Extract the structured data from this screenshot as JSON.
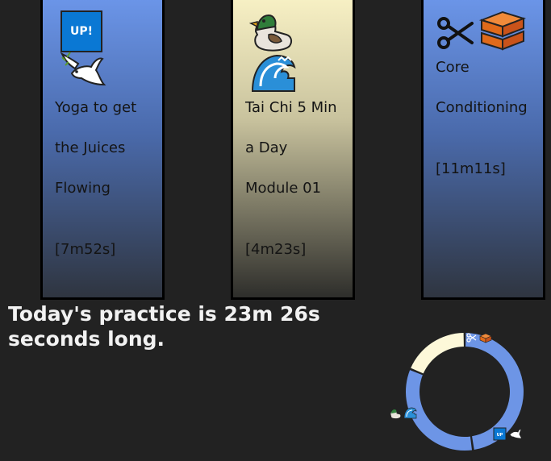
{
  "cards": [
    {
      "icons": [
        "up-badge-icon",
        "dove-icon"
      ],
      "badge_text": "UP!",
      "title_lines": [
        "Yoga to get",
        "the Juices",
        "Flowing"
      ],
      "duration": "[7m52s]",
      "color": "#6b95e8"
    },
    {
      "icons": [
        "duck-icon",
        "wave-icon"
      ],
      "title_lines": [
        "Tai Chi 5 Min",
        "a Day",
        "Module 01"
      ],
      "duration": "[4m23s]",
      "color": "#f7f0c4"
    },
    {
      "icons": [
        "scissors-icon",
        "brick-icon"
      ],
      "title_lines": [
        "Core",
        "Conditioning"
      ],
      "duration": "[11m11s]",
      "color": "#6b95e8"
    }
  ],
  "summary": {
    "line1": "Today's practice is 23m 26s",
    "line2": "seconds long."
  },
  "chart_data": {
    "type": "pie",
    "categories": [
      "Core Conditioning",
      "Yoga to get the Juices Flowing",
      "Tai Chi 5 Min a Day Module 01"
    ],
    "values": [
      671,
      472,
      263
    ],
    "units": "seconds",
    "colors": [
      "#6d95e6",
      "#6d95e6",
      "#fdf8d9"
    ],
    "donut": true
  }
}
